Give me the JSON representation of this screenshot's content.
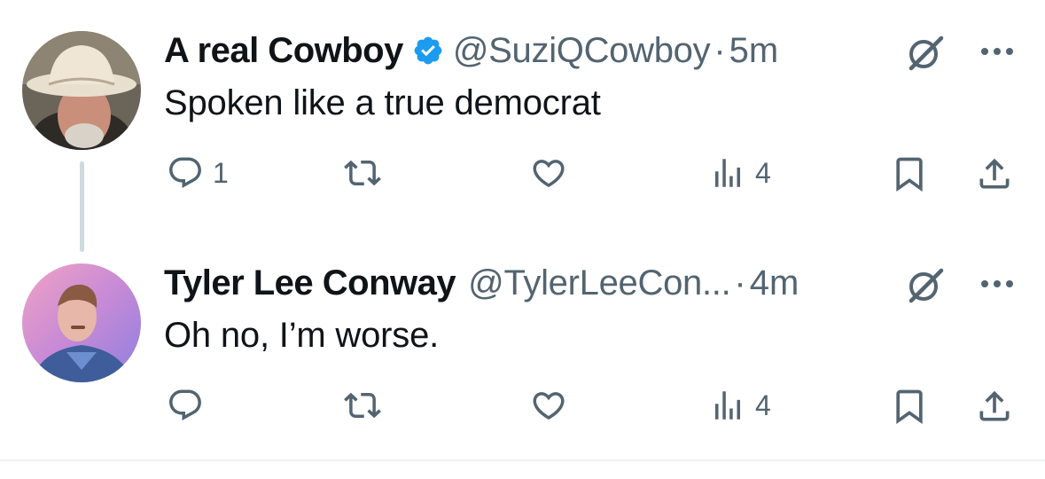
{
  "tweets": [
    {
      "display_name": "A real Cowboy",
      "verified": true,
      "handle": "@SuziQCowboy",
      "separator": "·",
      "time": "5m",
      "text": "Spoken like a true democrat",
      "replies": "1",
      "retweets": "",
      "likes": "",
      "views": "4"
    },
    {
      "display_name": "Tyler Lee Conway",
      "verified": false,
      "handle": "@TylerLeeCon...",
      "separator": "·",
      "time": "4m",
      "text": "Oh no, I’m worse.",
      "replies": "",
      "retweets": "",
      "likes": "",
      "views": "4"
    }
  ],
  "colors": {
    "text_primary": "#0f1419",
    "text_secondary": "#536471",
    "verified_blue": "#1d9bf0",
    "thread_line": "#cfd9de"
  },
  "icons": [
    "reply-icon",
    "retweet-icon",
    "like-icon",
    "views-icon",
    "bookmark-icon",
    "share-icon",
    "grok-icon",
    "more-icon",
    "verified-badge-icon"
  ]
}
